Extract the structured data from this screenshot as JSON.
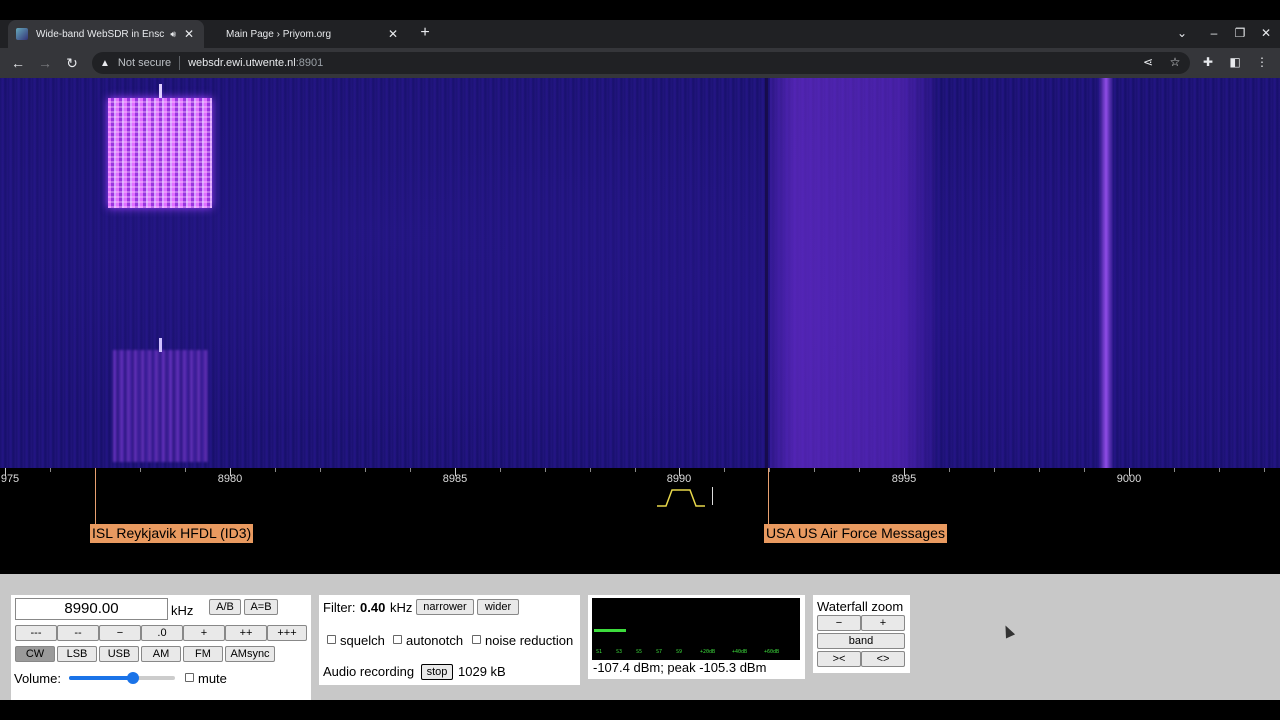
{
  "browser": {
    "tabs": [
      {
        "title": "Wide-band WebSDR in Ensch",
        "active": true,
        "audio": true
      },
      {
        "title": "Main Page › Priyom.org",
        "active": false,
        "audio": false
      }
    ],
    "address": {
      "security": "Not secure",
      "host": "websdr.ewi.utwente.nl",
      "port": ":8901"
    }
  },
  "scale": {
    "labels": [
      "975",
      "8980",
      "8985",
      "8990",
      "8995",
      "9000"
    ]
  },
  "stations": [
    {
      "label": "ISL Reykjavik HFDL (ID3)"
    },
    {
      "label": "USA US Air Force Messages"
    }
  ],
  "tuning": {
    "frequency": "8990.00",
    "unit": "kHz",
    "ab_label": "A/B",
    "aeqb_label": "A=B",
    "step_buttons": [
      "---",
      "--",
      "−",
      ".0",
      "+",
      "++",
      "+++"
    ],
    "modes": [
      "CW",
      "LSB",
      "USB",
      "AM",
      "FM",
      "AMsync"
    ],
    "selected_mode": "CW",
    "volume_label": "Volume:",
    "volume_level": 0.6,
    "mute_label": "mute"
  },
  "filter": {
    "label": "Filter:",
    "value": "0.40",
    "unit": "kHz",
    "narrower_label": "narrower",
    "wider_label": "wider",
    "squelch_label": "squelch",
    "autonotch_label": "autonotch",
    "noise_reduction_label": "noise reduction",
    "recording_label": "Audio recording",
    "stop_label": "stop",
    "recording_size": "1029 kB"
  },
  "smeter": {
    "scale_labels": [
      "S1",
      "S3",
      "S5",
      "S7",
      "S9",
      "+20dB",
      "+40dB",
      "+60dB"
    ],
    "reading": "-107.4 dBm; peak -105.3 dBm"
  },
  "waterfall_zoom": {
    "title": "Waterfall zoom",
    "minus_label": "−",
    "plus_label": "+",
    "band_label": "band",
    "narrow_label": "><",
    "wide_label": "<>"
  },
  "colors": {
    "waterfall_bg": "#1d137a",
    "signal": "#c070ff",
    "station_label": "#e99a60",
    "smeter_green": "#3ddc3d"
  }
}
